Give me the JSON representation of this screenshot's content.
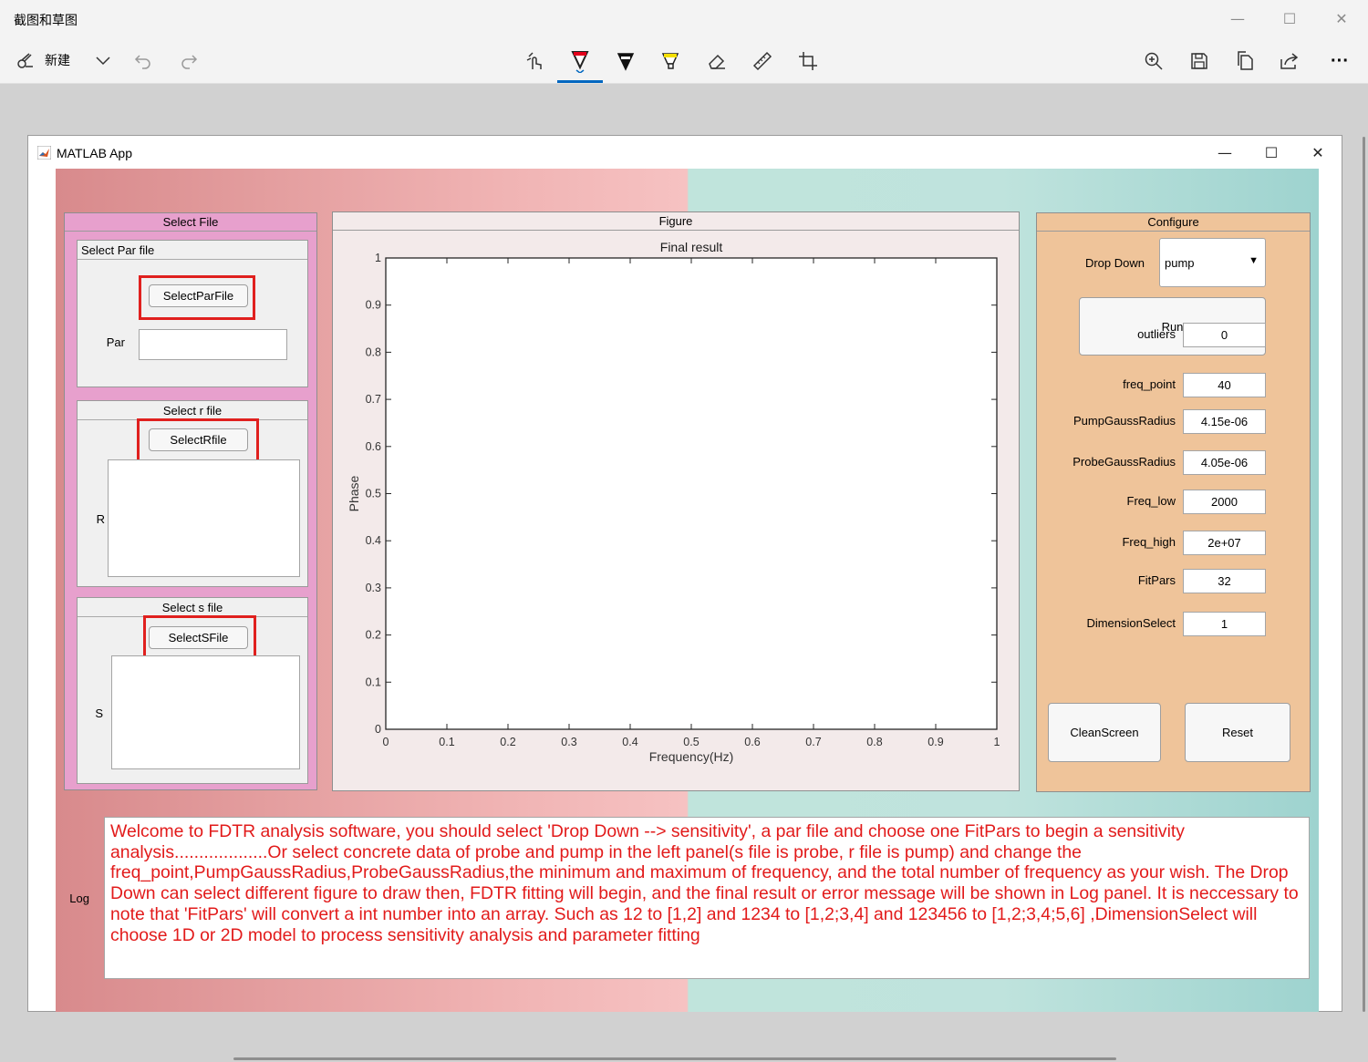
{
  "snip": {
    "title": "截图和草图",
    "new_label": "新建",
    "controls": {
      "minimize": "—",
      "maximize": "☐",
      "close": "✕"
    },
    "tools": [
      "touch-writing-icon",
      "ballpoint-pen-icon",
      "pencil-icon",
      "highlighter-icon",
      "eraser-icon",
      "ruler-icon",
      "crop-icon"
    ],
    "right_tools": [
      "zoom-icon",
      "save-icon",
      "copy-icon",
      "share-icon",
      "more-icon"
    ],
    "more_label": "···"
  },
  "matlab": {
    "title": "MATLAB App",
    "controls": {
      "minimize": "—",
      "maximize": "☐",
      "close": "✕"
    },
    "select_file": {
      "title": "Select File",
      "par": {
        "title": "Select Par file",
        "button": "SelectParFile",
        "field_label": "Par",
        "value": ""
      },
      "r": {
        "title": "Select r file",
        "button": "SelectRfile",
        "field_label": "R"
      },
      "s": {
        "title": "Select s file",
        "button": "SelectSFile",
        "field_label": "S"
      }
    },
    "figure": {
      "title": "Figure"
    },
    "configure": {
      "title": "Configure",
      "dropdown_label": "Drop Down",
      "dropdown_value": "pump",
      "run_label": "Run",
      "fields": [
        {
          "label": "outliers",
          "value": "0"
        },
        {
          "label": "freq_point",
          "value": "40"
        },
        {
          "label": "PumpGaussRadius",
          "value": "4.15e-06"
        },
        {
          "label": "ProbeGaussRadius",
          "value": "4.05e-06"
        },
        {
          "label": "Freq_low",
          "value": "2000"
        },
        {
          "label": "Freq_high",
          "value": "2e+07"
        },
        {
          "label": "FitPars",
          "value": "32"
        },
        {
          "label": "DimensionSelect",
          "value": "1"
        }
      ],
      "clean_label": "CleanScreen",
      "reset_label": "Reset"
    },
    "log": {
      "label": "Log",
      "text": "Welcome to FDTR analysis software, you should select 'Drop Down --> sensitivity', a par file and choose one FitPars to begin a sensitivity analysis...................Or select concrete data of probe and pump in the left panel(s file is probe, r file is pump) and change the freq_point,PumpGaussRadius,ProbeGaussRadius,the minimum and maximum of frequency, and the total number of frequency as your wish. The Drop Down can select different figure to draw then, FDTR fitting will begin, and the final result or error message will be shown in Log panel. It is neccessary to note that 'FitPars' will convert a int number into an array. Such as 12 to [1,2] and 1234 to [1,2;3,4] and 123456 to [1,2;3,4;5,6] ,DimensionSelect will choose 1D or 2D model to process sensitivity analysis and parameter fitting"
    }
  },
  "chart_data": {
    "type": "line",
    "title": "Final result",
    "xlabel": "Frequency(Hz)",
    "ylabel": "Phase",
    "xlim": [
      0,
      1
    ],
    "ylim": [
      0,
      1
    ],
    "xticks": [
      "0",
      "0.1",
      "0.2",
      "0.3",
      "0.4",
      "0.5",
      "0.6",
      "0.7",
      "0.8",
      "0.9",
      "1"
    ],
    "yticks": [
      "0",
      "0.1",
      "0.2",
      "0.3",
      "0.4",
      "0.5",
      "0.6",
      "0.7",
      "0.8",
      "0.9",
      "1"
    ],
    "series": [],
    "grid": false
  }
}
